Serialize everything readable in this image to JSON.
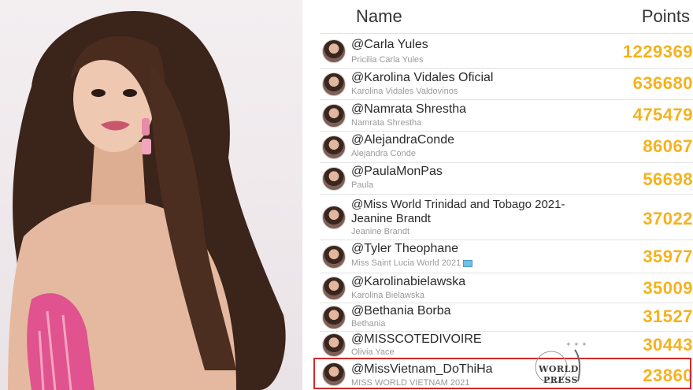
{
  "header": {
    "name_label": "Name",
    "points_label": "Points"
  },
  "colors": {
    "score": "#f5b21c",
    "highlight": "#d62828"
  },
  "rows": [
    {
      "handle": "@Carla Yules",
      "sub": "Pricilia Carla Yules",
      "points": "1229369"
    },
    {
      "handle": "@Karolina Vidales Oficial",
      "sub": "Karolina Vidales Valdovinos",
      "points": "636680"
    },
    {
      "handle": "@Namrata Shrestha",
      "sub": "Namrata Shrestha",
      "points": "475479"
    },
    {
      "handle": "@AlejandraConde",
      "sub": "Alejandra Conde",
      "points": "86067"
    },
    {
      "handle": "@PaulaMonPas",
      "sub": "Paula",
      "points": "56698"
    },
    {
      "handle": "@Miss World Trinidad and Tobago 2021- Jeanine Brandt",
      "sub": "Jeanine Brandt",
      "points": "37022"
    },
    {
      "handle": "@Tyler Theophane",
      "sub": "Miss Saint Lucia World 2021",
      "points": "35977"
    },
    {
      "handle": "@Karolinabielawska",
      "sub": "Karolina Bielawska",
      "points": "35009"
    },
    {
      "handle": "@Bethania Borba",
      "sub": "Bethania",
      "points": "31527"
    },
    {
      "handle": "@MISSCOTEDIVOIRE",
      "sub": "Olivia Yace",
      "points": "30443"
    },
    {
      "handle": "@MissVietnam_DoThiHa",
      "sub": "MISS WORLD VIETNAM 2021",
      "points": "23860"
    }
  ],
  "watermark": {
    "line1": "WORLD",
    "line2": "PRESS"
  }
}
